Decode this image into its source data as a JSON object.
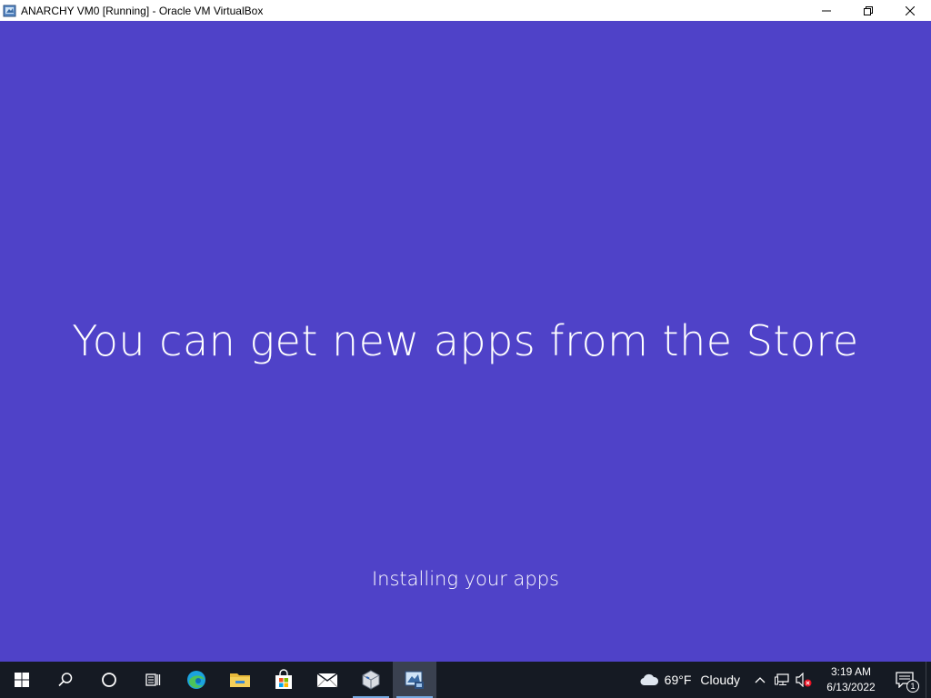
{
  "window": {
    "title": "ANARCHY VM0 [Running] - Oracle VM VirtualBox"
  },
  "vm": {
    "heading": "You can get new apps from the Store",
    "status": "Installing your apps",
    "background_color": "#4f42c8"
  },
  "taskbar": {
    "apps": [
      "start-icon",
      "search-icon",
      "cortana-icon",
      "task-view-icon",
      "edge-icon",
      "file-explorer-icon",
      "store-icon",
      "mail-icon",
      "virtualbox-icon",
      "virtualbox-vm-icon"
    ],
    "weather": {
      "temp": "69°F",
      "condition": "Cloudy"
    },
    "clock": {
      "time": "3:19 AM",
      "date": "6/13/2022"
    },
    "notification_count": "1"
  }
}
